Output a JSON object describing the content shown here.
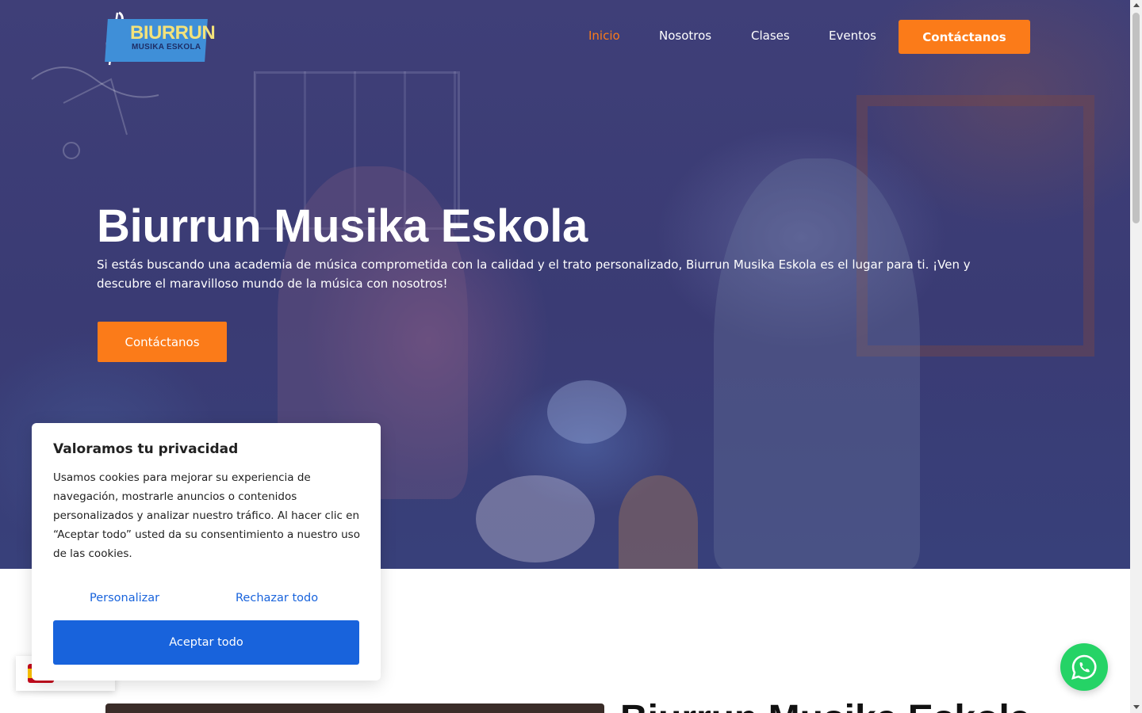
{
  "header": {
    "logo_top": "BIURRUN",
    "logo_bottom": "MUSIKA ESKOLA",
    "nav": [
      {
        "label": "Inicio",
        "active": true
      },
      {
        "label": "Nosotros"
      },
      {
        "label": "Clases"
      },
      {
        "label": "Eventos"
      }
    ],
    "cta": "Contáctanos"
  },
  "hero": {
    "title": "Biurrun Musika Eskola",
    "description": "Si estás buscando una academia de música comprometida con la calidad y el trato personalizado, Biurrun Musika Eskola es el lugar para ti. ¡Ven y descubre el maravilloso mundo de la música con nosotros!",
    "cta": "Contáctanos"
  },
  "section": {
    "title": "Biurrun Musika Eskola"
  },
  "cookie": {
    "title": "Valoramos tu privacidad",
    "text": "Usamos cookies para mejorar su experiencia de navegación, mostrarle anuncios o contenidos personalizados y analizar nuestro tráfico. Al hacer clic en “Aceptar todo” usted da su consentimiento a nuestro uso de las cookies.",
    "customize": "Personalizar",
    "reject": "Rechazar todo",
    "accept": "Aceptar todo"
  },
  "language": {
    "flag_icon": "spain-flag-icon"
  },
  "whatsapp": {
    "icon": "whatsapp-icon"
  },
  "colors": {
    "accent": "#fb7b19",
    "cookie_blue": "#1863dc",
    "whatsapp_green": "#25d366",
    "hero_overlay": "#3f3f78"
  }
}
